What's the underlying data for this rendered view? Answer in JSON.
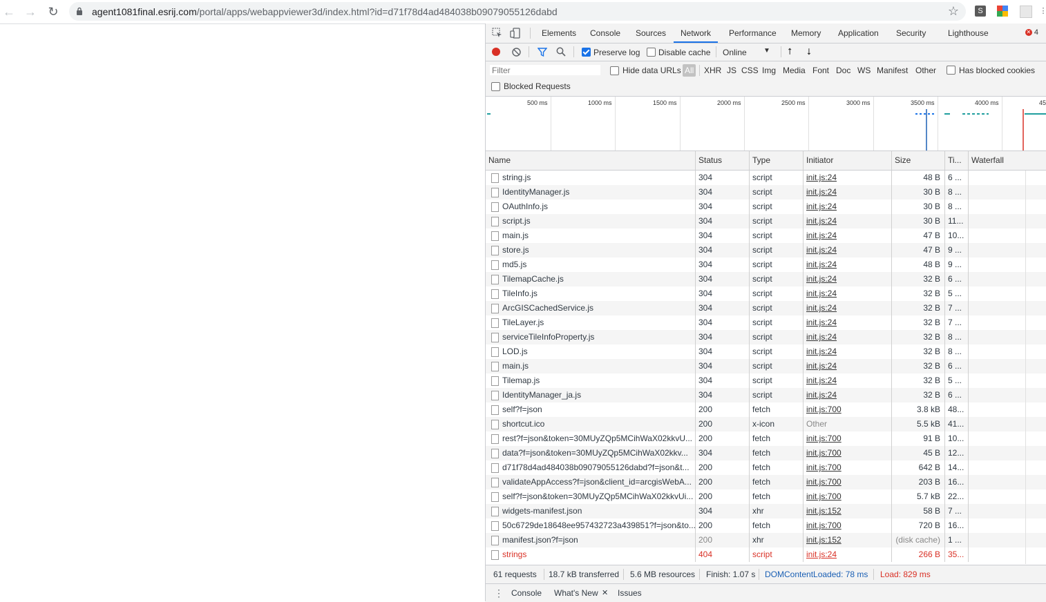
{
  "browser": {
    "url_host": "agent1081final.esrij.com",
    "url_path": "/portal/apps/webappviewer3d/index.html?id=d71f78d4ad484038b09079055126dabd",
    "ext_s_label": "S"
  },
  "devtools": {
    "tabs": [
      "Elements",
      "Console",
      "Sources",
      "Network",
      "Performance",
      "Memory",
      "Application",
      "Security",
      "Lighthouse"
    ],
    "active_tab": "Network",
    "error_count": "4",
    "toolbar": {
      "preserve_log": "Preserve log",
      "preserve_log_checked": true,
      "disable_cache": "Disable cache",
      "throttle": "Online"
    },
    "filter": {
      "placeholder": "Filter",
      "hide_data_urls": "Hide data URLs",
      "types": [
        "All",
        "XHR",
        "JS",
        "CSS",
        "Img",
        "Media",
        "Font",
        "Doc",
        "WS",
        "Manifest",
        "Other"
      ],
      "has_blocked_cookies": "Has blocked cookies",
      "blocked_requests": "Blocked Requests"
    },
    "overview_ticks": [
      "500 ms",
      "1000 ms",
      "1500 ms",
      "2000 ms",
      "2500 ms",
      "3000 ms",
      "3500 ms",
      "4000 ms",
      "45"
    ],
    "columns": {
      "name": "Name",
      "status": "Status",
      "type": "Type",
      "initiator": "Initiator",
      "size": "Size",
      "time": "Ti...",
      "waterfall": "Waterfall"
    },
    "rows": [
      {
        "name": "string.js",
        "status": "304",
        "type": "script",
        "initiator": "init.js:24",
        "size": "48 B",
        "time": "6 ..."
      },
      {
        "name": "IdentityManager.js",
        "status": "304",
        "type": "script",
        "initiator": "init.js:24",
        "size": "30 B",
        "time": "8 ..."
      },
      {
        "name": "OAuthInfo.js",
        "status": "304",
        "type": "script",
        "initiator": "init.js:24",
        "size": "30 B",
        "time": "8 ..."
      },
      {
        "name": "script.js",
        "status": "304",
        "type": "script",
        "initiator": "init.js:24",
        "size": "30 B",
        "time": "11..."
      },
      {
        "name": "main.js",
        "status": "304",
        "type": "script",
        "initiator": "init.js:24",
        "size": "47 B",
        "time": "10..."
      },
      {
        "name": "store.js",
        "status": "304",
        "type": "script",
        "initiator": "init.js:24",
        "size": "47 B",
        "time": "9 ..."
      },
      {
        "name": "md5.js",
        "status": "304",
        "type": "script",
        "initiator": "init.js:24",
        "size": "48 B",
        "time": "9 ..."
      },
      {
        "name": "TilemapCache.js",
        "status": "304",
        "type": "script",
        "initiator": "init.js:24",
        "size": "32 B",
        "time": "6 ..."
      },
      {
        "name": "TileInfo.js",
        "status": "304",
        "type": "script",
        "initiator": "init.js:24",
        "size": "32 B",
        "time": "5 ..."
      },
      {
        "name": "ArcGISCachedService.js",
        "status": "304",
        "type": "script",
        "initiator": "init.js:24",
        "size": "32 B",
        "time": "7 ..."
      },
      {
        "name": "TileLayer.js",
        "status": "304",
        "type": "script",
        "initiator": "init.js:24",
        "size": "32 B",
        "time": "7 ..."
      },
      {
        "name": "serviceTileInfoProperty.js",
        "status": "304",
        "type": "script",
        "initiator": "init.js:24",
        "size": "32 B",
        "time": "8 ..."
      },
      {
        "name": "LOD.js",
        "status": "304",
        "type": "script",
        "initiator": "init.js:24",
        "size": "32 B",
        "time": "8 ..."
      },
      {
        "name": "main.js",
        "status": "304",
        "type": "script",
        "initiator": "init.js:24",
        "size": "32 B",
        "time": "6 ..."
      },
      {
        "name": "Tilemap.js",
        "status": "304",
        "type": "script",
        "initiator": "init.js:24",
        "size": "32 B",
        "time": "5 ..."
      },
      {
        "name": "IdentityManager_ja.js",
        "status": "304",
        "type": "script",
        "initiator": "init.js:24",
        "size": "32 B",
        "time": "6 ..."
      },
      {
        "name": "self?f=json",
        "status": "200",
        "type": "fetch",
        "initiator": "init.js:700",
        "size": "3.8 kB",
        "time": "48..."
      },
      {
        "name": "shortcut.ico",
        "status": "200",
        "type": "x-icon",
        "initiator": "Other",
        "size": "5.5 kB",
        "time": "41..."
      },
      {
        "name": "rest?f=json&token=30MUyZQp5MCihWaX02kkvU...",
        "status": "200",
        "type": "fetch",
        "initiator": "init.js:700",
        "size": "91 B",
        "time": "10..."
      },
      {
        "name": "data?f=json&token=30MUyZQp5MCihWaX02kkv...",
        "status": "304",
        "type": "fetch",
        "initiator": "init.js:700",
        "size": "45 B",
        "time": "12..."
      },
      {
        "name": "d71f78d4ad484038b09079055126dabd?f=json&t...",
        "status": "200",
        "type": "fetch",
        "initiator": "init.js:700",
        "size": "642 B",
        "time": "14..."
      },
      {
        "name": "validateAppAccess?f=json&client_id=arcgisWebA...",
        "status": "200",
        "type": "fetch",
        "initiator": "init.js:700",
        "size": "203 B",
        "time": "16..."
      },
      {
        "name": "self?f=json&token=30MUyZQp5MCihWaX02kkvUi...",
        "status": "200",
        "type": "fetch",
        "initiator": "init.js:700",
        "size": "5.7 kB",
        "time": "22..."
      },
      {
        "name": "widgets-manifest.json",
        "status": "304",
        "type": "xhr",
        "initiator": "init.js:152",
        "size": "58 B",
        "time": "7 ..."
      },
      {
        "name": "50c6729de18648ee957432723a439851?f=json&to...",
        "status": "200",
        "type": "fetch",
        "initiator": "init.js:700",
        "size": "720 B",
        "time": "16..."
      },
      {
        "name": "manifest.json?f=json",
        "status": "200",
        "type": "xhr",
        "initiator": "init.js:152",
        "size": "(disk cache)",
        "time": "1 ..."
      },
      {
        "name": "strings",
        "status": "404",
        "type": "script",
        "initiator": "init.js:24",
        "size": "266 B",
        "time": "35..."
      }
    ],
    "summary": {
      "requests": "61 requests",
      "transferred": "18.7 kB transferred",
      "resources": "5.6 MB resources",
      "finish": "Finish: 1.07 s",
      "dcl": "DOMContentLoaded: 78 ms",
      "load": "Load: 829 ms"
    },
    "drawer": {
      "console": "Console",
      "whats_new": "What's New",
      "issues": "Issues"
    }
  },
  "colors": {
    "accent": "#1a73e8",
    "error": "#d93025",
    "dcl": "#1a5fb4"
  }
}
